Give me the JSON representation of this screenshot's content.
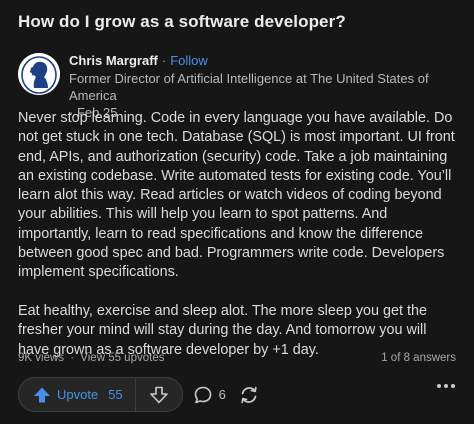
{
  "question": {
    "title": "How do I grow as a software developer?"
  },
  "author": {
    "name": "Chris Margraff",
    "separator": "·",
    "follow_label": "Follow",
    "credential": "Former Director of Artificial Intelligence at The United States of America",
    "date_prefix": "·",
    "date": "Feb 25",
    "avatar_icon": "silhouette-portrait-icon"
  },
  "answer": {
    "paragraphs": [
      "Never stop learning. Code in every language you have available. Do not get stuck in one tech. Database (SQL) is most important. UI front end, APIs, and authorization (security) code. Take a job maintaining an existing codebase. Write automated tests for existing code. You’ll learn alot this way. Read articles or watch videos of coding beyond your abilities. This will help you learn to spot patterns. And importantly, learn to read specifications and know the difference between good spec and bad. Programmers write code. Developers implement specifications.",
      "Eat healthy, exercise and sleep alot. The more sleep you get the fresher your mind will stay during the day. And tomorrow you will have grown as a software developer by +1 day."
    ]
  },
  "stats": {
    "views": "9K views",
    "separator": "·",
    "upvotes_link": "View 55 upvotes",
    "answer_position": "1 of 8 answers"
  },
  "actions": {
    "upvote_label": "Upvote",
    "upvote_count": "55",
    "comment_count": "6",
    "icons": {
      "upvote": "upvote-arrow-icon",
      "downvote": "downvote-arrow-icon",
      "comment": "comment-bubble-icon",
      "share": "share-cycle-icon",
      "more": "more-horizontal-icon"
    }
  },
  "colors": {
    "background": "#161616",
    "text": "#dcdcdc",
    "accent_blue": "#4a8fe7",
    "muted": "#a8a8a8"
  }
}
